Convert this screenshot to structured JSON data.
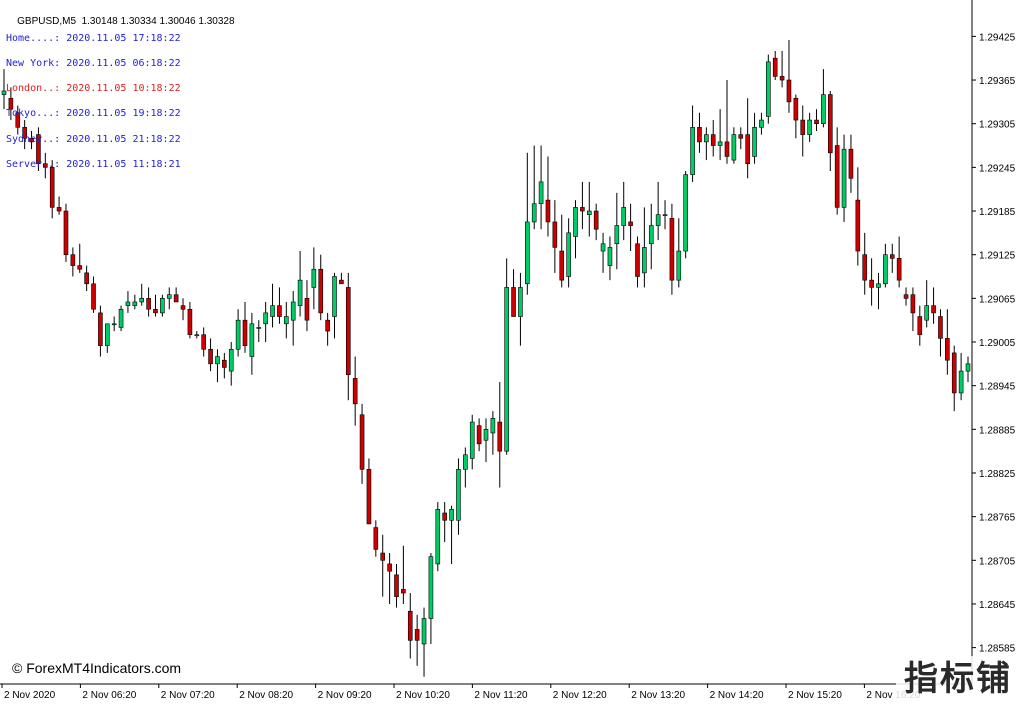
{
  "header": {
    "symbol": "GBPUSD,M5",
    "ohlc": "1.30148 1.30334 1.30046 1.30328"
  },
  "clocks": [
    {
      "label": "Home....:",
      "value": "2020.11.05 17:18:22",
      "color": "#1f1fd8"
    },
    {
      "label": "New York:",
      "value": "2020.11.05 06:18:22",
      "color": "#1f1fd8"
    },
    {
      "label": "London..:",
      "value": "2020.11.05 10:18:22",
      "color": "#e02020"
    },
    {
      "label": "Tokyo...:",
      "value": "2020.11.05 19:18:22",
      "color": "#1f1fd8"
    },
    {
      "label": "Sydney..:",
      "value": "2020.11.05 21:18:22",
      "color": "#1f1fd8"
    },
    {
      "label": "Server..:",
      "value": "2020.11.05 11:18:21",
      "color": "#1f1fd8"
    }
  ],
  "watermark": "© ForexMT4Indicators.com",
  "corner_badge": "指标铺",
  "colors": {
    "bull": "#00cc66",
    "bear": "#cc0000",
    "wick": "#000000",
    "axis": "#000000",
    "background": "#ffffff"
  },
  "chart_data": {
    "type": "candlestick",
    "ylim": [
      1.28535,
      1.29475
    ],
    "y_ticks": [
      "1.29425",
      "1.29365",
      "1.29305",
      "1.29245",
      "1.29185",
      "1.29125",
      "1.29065",
      "1.29005",
      "1.28945",
      "1.28885",
      "1.28825",
      "1.28765",
      "1.28705",
      "1.28645",
      "1.28585"
    ],
    "x_labels": [
      "2 Nov 2020",
      "2 Nov 06:20",
      "2 Nov 07:20",
      "2 Nov 08:20",
      "2 Nov 09:20",
      "2 Nov 10:20",
      "2 Nov 11:20",
      "2 Nov 12:20",
      "2 Nov 13:20",
      "2 Nov 14:20",
      "2 Nov 15:20",
      "2 Nov 16:20"
    ],
    "candles": [
      [
        1.29345,
        1.2938,
        1.29325,
        1.2935
      ],
      [
        1.2934,
        1.29355,
        1.2931,
        1.29325
      ],
      [
        1.2932,
        1.2933,
        1.2929,
        1.293
      ],
      [
        1.293,
        1.2931,
        1.2927,
        1.29285
      ],
      [
        1.29285,
        1.29295,
        1.2927,
        1.2928
      ],
      [
        1.2929,
        1.293,
        1.2924,
        1.2925
      ],
      [
        1.2925,
        1.29265,
        1.2923,
        1.29245
      ],
      [
        1.29245,
        1.29255,
        1.29175,
        1.2919
      ],
      [
        1.2919,
        1.29205,
        1.2918,
        1.29185
      ],
      [
        1.29185,
        1.29195,
        1.29115,
        1.29125
      ],
      [
        1.29125,
        1.29135,
        1.29095,
        1.2911
      ],
      [
        1.2911,
        1.2914,
        1.291,
        1.29105
      ],
      [
        1.291,
        1.2911,
        1.29075,
        1.29085
      ],
      [
        1.29085,
        1.29095,
        1.29045,
        1.2905
      ],
      [
        1.29045,
        1.29055,
        1.28985,
        1.29
      ],
      [
        1.29,
        1.2903,
        1.2899,
        1.2903
      ],
      [
        1.2903,
        1.2904,
        1.2902,
        1.2903
      ],
      [
        1.29025,
        1.29055,
        1.2902,
        1.2905
      ],
      [
        1.29055,
        1.29075,
        1.29045,
        1.2906
      ],
      [
        1.29055,
        1.2907,
        1.2905,
        1.2906
      ],
      [
        1.2906,
        1.29085,
        1.29055,
        1.29065
      ],
      [
        1.29065,
        1.2908,
        1.2904,
        1.2905
      ],
      [
        1.2905,
        1.2907,
        1.2904,
        1.29045
      ],
      [
        1.29045,
        1.2907,
        1.2904,
        1.29065
      ],
      [
        1.29065,
        1.2908,
        1.2905,
        1.2907
      ],
      [
        1.2907,
        1.2908,
        1.2906,
        1.2906
      ],
      [
        1.29055,
        1.29065,
        1.29035,
        1.2905
      ],
      [
        1.2905,
        1.2906,
        1.2901,
        1.29015
      ],
      [
        1.29015,
        1.2902,
        1.2901,
        1.29015
      ],
      [
        1.29015,
        1.29025,
        1.28985,
        1.28995
      ],
      [
        1.28995,
        1.2901,
        1.28965,
        1.28975
      ],
      [
        1.28975,
        1.28995,
        1.2895,
        1.28985
      ],
      [
        1.2898,
        1.2899,
        1.28955,
        1.2897
      ],
      [
        1.28965,
        1.29005,
        1.28945,
        1.28995
      ],
      [
        1.28995,
        1.2905,
        1.28985,
        1.29035
      ],
      [
        1.29035,
        1.2906,
        1.2899,
        1.29
      ],
      [
        1.28985,
        1.29045,
        1.2896,
        1.2903
      ],
      [
        1.29025,
        1.29035,
        1.29005,
        1.29025
      ],
      [
        1.2903,
        1.2906,
        1.29005,
        1.29045
      ],
      [
        1.2904,
        1.29085,
        1.29025,
        1.29055
      ],
      [
        1.29055,
        1.2908,
        1.2903,
        1.2904
      ],
      [
        1.2903,
        1.2906,
        1.2901,
        1.2904
      ],
      [
        1.29035,
        1.29075,
        1.29,
        1.2906
      ],
      [
        1.29055,
        1.2913,
        1.2904,
        1.2909
      ],
      [
        1.29065,
        1.2909,
        1.2902,
        1.29035
      ],
      [
        1.2908,
        1.29135,
        1.2905,
        1.29105
      ],
      [
        1.29105,
        1.29125,
        1.29035,
        1.29045
      ],
      [
        1.29035,
        1.29045,
        1.29,
        1.2902
      ],
      [
        1.2904,
        1.291,
        1.2901,
        1.29095
      ],
      [
        1.2909,
        1.291,
        1.29085,
        1.29085
      ],
      [
        1.2908,
        1.291,
        1.28925,
        1.2896
      ],
      [
        1.28955,
        1.28985,
        1.2889,
        1.2892
      ],
      [
        1.28905,
        1.2892,
        1.2881,
        1.2883
      ],
      [
        1.2883,
        1.28845,
        1.28755,
        1.28755
      ],
      [
        1.2875,
        1.2876,
        1.2871,
        1.2872
      ],
      [
        1.28715,
        1.2874,
        1.28655,
        1.28705
      ],
      [
        1.287,
        1.28715,
        1.28645,
        1.2869
      ],
      [
        1.28685,
        1.287,
        1.2864,
        1.28655
      ],
      [
        1.28665,
        1.28725,
        1.28645,
        1.2866
      ],
      [
        1.28635,
        1.2866,
        1.2857,
        1.28595
      ],
      [
        1.2861,
        1.2863,
        1.2856,
        1.28595
      ],
      [
        1.2859,
        1.2864,
        1.28545,
        1.28625
      ],
      [
        1.28625,
        1.28715,
        1.2859,
        1.2871
      ],
      [
        1.287,
        1.28785,
        1.2869,
        1.28775
      ],
      [
        1.2877,
        1.28785,
        1.2873,
        1.2876
      ],
      [
        1.2876,
        1.2878,
        1.287,
        1.28775
      ],
      [
        1.2876,
        1.28845,
        1.2874,
        1.2883
      ],
      [
        1.2883,
        1.2886,
        1.28805,
        1.2885
      ],
      [
        1.28845,
        1.28905,
        1.2883,
        1.28895
      ],
      [
        1.2889,
        1.289,
        1.28855,
        1.28865
      ],
      [
        1.2887,
        1.289,
        1.2884,
        1.28885
      ],
      [
        1.2888,
        1.2891,
        1.2885,
        1.289
      ],
      [
        1.28895,
        1.2895,
        1.28805,
        1.28855
      ],
      [
        1.28855,
        1.2912,
        1.2885,
        1.2908
      ],
      [
        1.2908,
        1.29105,
        1.2905,
        1.2904
      ],
      [
        1.2904,
        1.291,
        1.29,
        1.2908
      ],
      [
        1.29085,
        1.29265,
        1.2907,
        1.2917
      ],
      [
        1.2917,
        1.29275,
        1.2916,
        1.29195
      ],
      [
        1.29195,
        1.29275,
        1.2916,
        1.29225
      ],
      [
        1.292,
        1.2926,
        1.2915,
        1.2917
      ],
      [
        1.2917,
        1.292,
        1.291,
        1.29135
      ],
      [
        1.2913,
        1.2918,
        1.2908,
        1.2909
      ],
      [
        1.29095,
        1.29175,
        1.2908,
        1.29155
      ],
      [
        1.2915,
        1.292,
        1.2912,
        1.2919
      ],
      [
        1.2919,
        1.29225,
        1.2916,
        1.29185
      ],
      [
        1.2918,
        1.29225,
        1.2915,
        1.29185
      ],
      [
        1.29185,
        1.29195,
        1.29145,
        1.2916
      ],
      [
        1.2913,
        1.29155,
        1.291,
        1.2914
      ],
      [
        1.2911,
        1.2915,
        1.2909,
        1.29135
      ],
      [
        1.2914,
        1.2921,
        1.29105,
        1.29165
      ],
      [
        1.29165,
        1.29225,
        1.29145,
        1.2919
      ],
      [
        1.2917,
        1.29195,
        1.2913,
        1.29165
      ],
      [
        1.2914,
        1.2915,
        1.2908,
        1.29095
      ],
      [
        1.291,
        1.2919,
        1.2908,
        1.29135
      ],
      [
        1.2914,
        1.29195,
        1.29105,
        1.29165
      ],
      [
        1.29165,
        1.29225,
        1.29145,
        1.2918
      ],
      [
        1.2918,
        1.292,
        1.2916,
        1.2918
      ],
      [
        1.29175,
        1.29195,
        1.2907,
        1.2909
      ],
      [
        1.2909,
        1.29175,
        1.2908,
        1.2913
      ],
      [
        1.2913,
        1.2924,
        1.2912,
        1.29235
      ],
      [
        1.29235,
        1.2933,
        1.29225,
        1.293
      ],
      [
        1.293,
        1.2932,
        1.29265,
        1.2928
      ],
      [
        1.2928,
        1.293,
        1.29255,
        1.2929
      ],
      [
        1.2929,
        1.2931,
        1.2926,
        1.29275
      ],
      [
        1.29275,
        1.29325,
        1.29255,
        1.2928
      ],
      [
        1.2928,
        1.29365,
        1.2925,
        1.2926
      ],
      [
        1.29255,
        1.293,
        1.2925,
        1.2929
      ],
      [
        1.2929,
        1.293,
        1.2927,
        1.29285
      ],
      [
        1.2929,
        1.2934,
        1.2923,
        1.2925
      ],
      [
        1.2926,
        1.2932,
        1.2925,
        1.293
      ],
      [
        1.293,
        1.2932,
        1.2929,
        1.2931
      ],
      [
        1.29315,
        1.294,
        1.29305,
        1.2939
      ],
      [
        1.29395,
        1.29405,
        1.29365,
        1.2937
      ],
      [
        1.2937,
        1.29405,
        1.29355,
        1.29365
      ],
      [
        1.29365,
        1.2942,
        1.2932,
        1.29335
      ],
      [
        1.2934,
        1.29345,
        1.29285,
        1.2931
      ],
      [
        1.2931,
        1.2933,
        1.2926,
        1.2929
      ],
      [
        1.2929,
        1.2932,
        1.2928,
        1.2931
      ],
      [
        1.2931,
        1.29325,
        1.29295,
        1.29305
      ],
      [
        1.29305,
        1.2938,
        1.293,
        1.29345
      ],
      [
        1.29345,
        1.2935,
        1.2924,
        1.29265
      ],
      [
        1.29275,
        1.293,
        1.2918,
        1.2919
      ],
      [
        1.2919,
        1.2929,
        1.2917,
        1.2927
      ],
      [
        1.2927,
        1.2929,
        1.2921,
        1.2923
      ],
      [
        1.292,
        1.29245,
        1.2911,
        1.2913
      ],
      [
        1.29125,
        1.29155,
        1.2907,
        1.2909
      ],
      [
        1.2909,
        1.2912,
        1.29055,
        1.2908
      ],
      [
        1.2908,
        1.291,
        1.2905,
        1.29085
      ],
      [
        1.29085,
        1.2914,
        1.2908,
        1.29125
      ],
      [
        1.29125,
        1.2914,
        1.291,
        1.2912
      ],
      [
        1.2912,
        1.2915,
        1.2908,
        1.2909
      ],
      [
        1.2907,
        1.2908,
        1.29055,
        1.29065
      ],
      [
        1.2907,
        1.2908,
        1.2902,
        1.29045
      ],
      [
        1.2904,
        1.29055,
        1.29,
        1.29015
      ],
      [
        1.29035,
        1.2909,
        1.29025,
        1.29055
      ],
      [
        1.29055,
        1.2908,
        1.2903,
        1.29045
      ],
      [
        1.2904,
        1.2905,
        1.28985,
        1.2901
      ],
      [
        1.2901,
        1.2905,
        1.2896,
        1.2898
      ],
      [
        1.2899,
        1.29,
        1.2891,
        1.28935
      ],
      [
        1.28935,
        1.2899,
        1.28925,
        1.28965
      ],
      [
        1.28965,
        1.28985,
        1.2895,
        1.28975
      ]
    ]
  }
}
